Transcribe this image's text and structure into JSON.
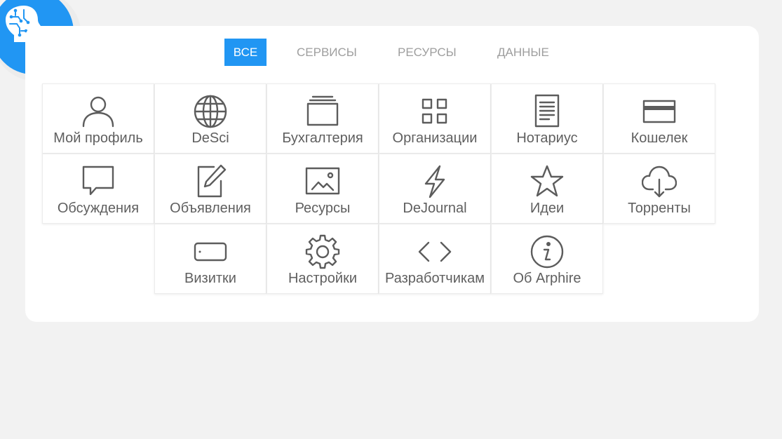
{
  "tabs": [
    {
      "label": "ВСЕ",
      "active": true
    },
    {
      "label": "СЕРВИСЫ",
      "active": false
    },
    {
      "label": "РЕСУРСЫ",
      "active": false
    },
    {
      "label": "ДАННЫЕ",
      "active": false
    }
  ],
  "colors": {
    "accent": "#2196f3",
    "background": "#f2f2f2",
    "card": "#ffffff",
    "text": "#5f5f5f",
    "tab_inactive": "#9e9e9e"
  },
  "logo": {
    "icon": "ai-head-icon"
  },
  "tiles": [
    {
      "label": "Мой профиль",
      "icon": "user-icon"
    },
    {
      "label": "DeSci",
      "icon": "globe-icon"
    },
    {
      "label": "Бухгалтерия",
      "icon": "folders-icon"
    },
    {
      "label": "Организации",
      "icon": "grid-icon"
    },
    {
      "label": "Нотариус",
      "icon": "document-icon"
    },
    {
      "label": "Кошелек",
      "icon": "card-icon"
    },
    {
      "label": "Обсуждения",
      "icon": "chat-icon"
    },
    {
      "label": "Объявления",
      "icon": "edit-icon"
    },
    {
      "label": "Ресурсы",
      "icon": "image-icon"
    },
    {
      "label": "DeJournal",
      "icon": "lightning-icon"
    },
    {
      "label": "Идеи",
      "icon": "star-icon"
    },
    {
      "label": "Торренты",
      "icon": "cloud-download-icon"
    },
    {
      "label": "Визитки",
      "icon": "business-card-icon"
    },
    {
      "label": "Настройки",
      "icon": "gear-icon"
    },
    {
      "label": "Разработчикам",
      "icon": "code-icon"
    },
    {
      "label": "Об Arphire",
      "icon": "info-icon"
    }
  ]
}
